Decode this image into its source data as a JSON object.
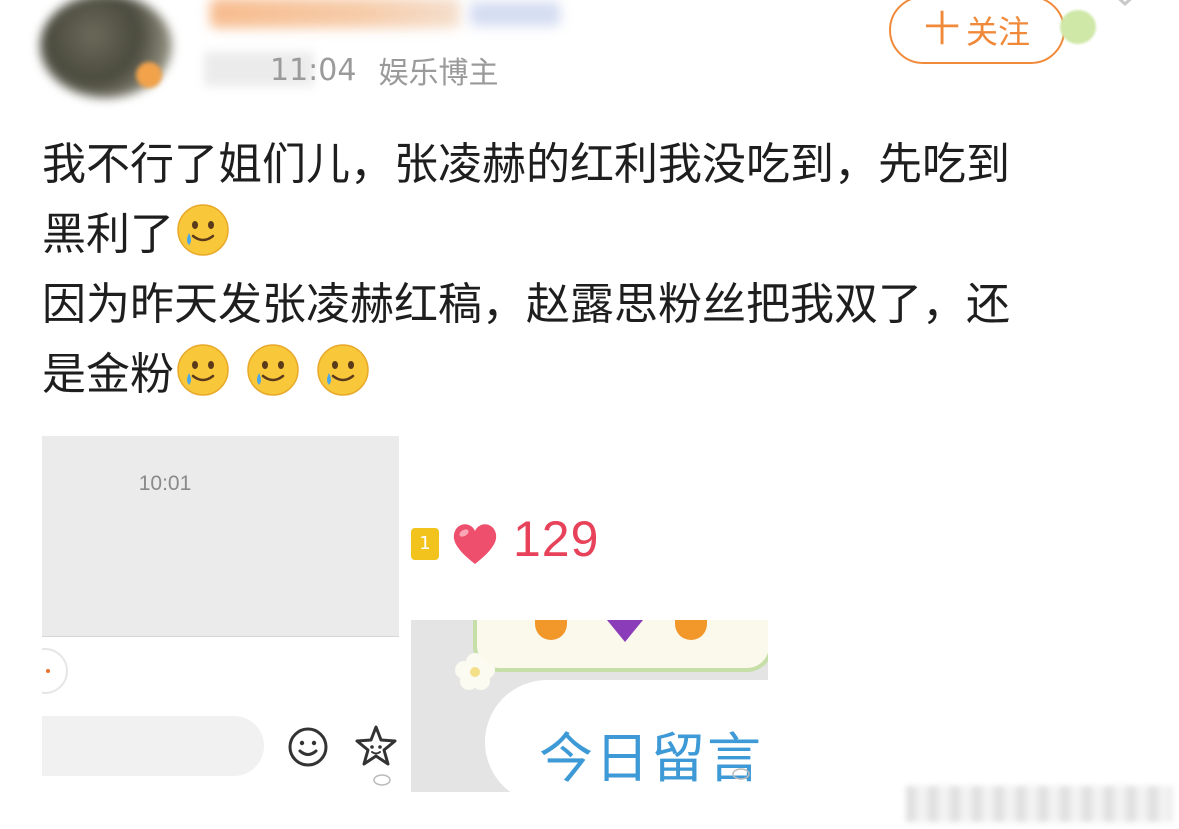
{
  "header": {
    "meta_time": "11:04",
    "user_tag": "娱乐博主",
    "follow_label": "关注",
    "follow_plus": "十"
  },
  "post": {
    "line1": "我不行了姐们儿，张凌赫的红利我没吃到，先吃到",
    "line2": "黑利了",
    "line3": "因为昨天发张凌赫红稿，赵露思粉丝把我双了，还",
    "line4": "是金粉",
    "emoji": "smiling-face-with-tear-icon"
  },
  "image1": {
    "chat_time": "10:01"
  },
  "image2": {
    "level": "1",
    "likes": "129",
    "message_label": "今日留言"
  },
  "colors": {
    "accent": "#f08a3a",
    "likes": "#e7425a",
    "message": "#3d9ad6"
  }
}
